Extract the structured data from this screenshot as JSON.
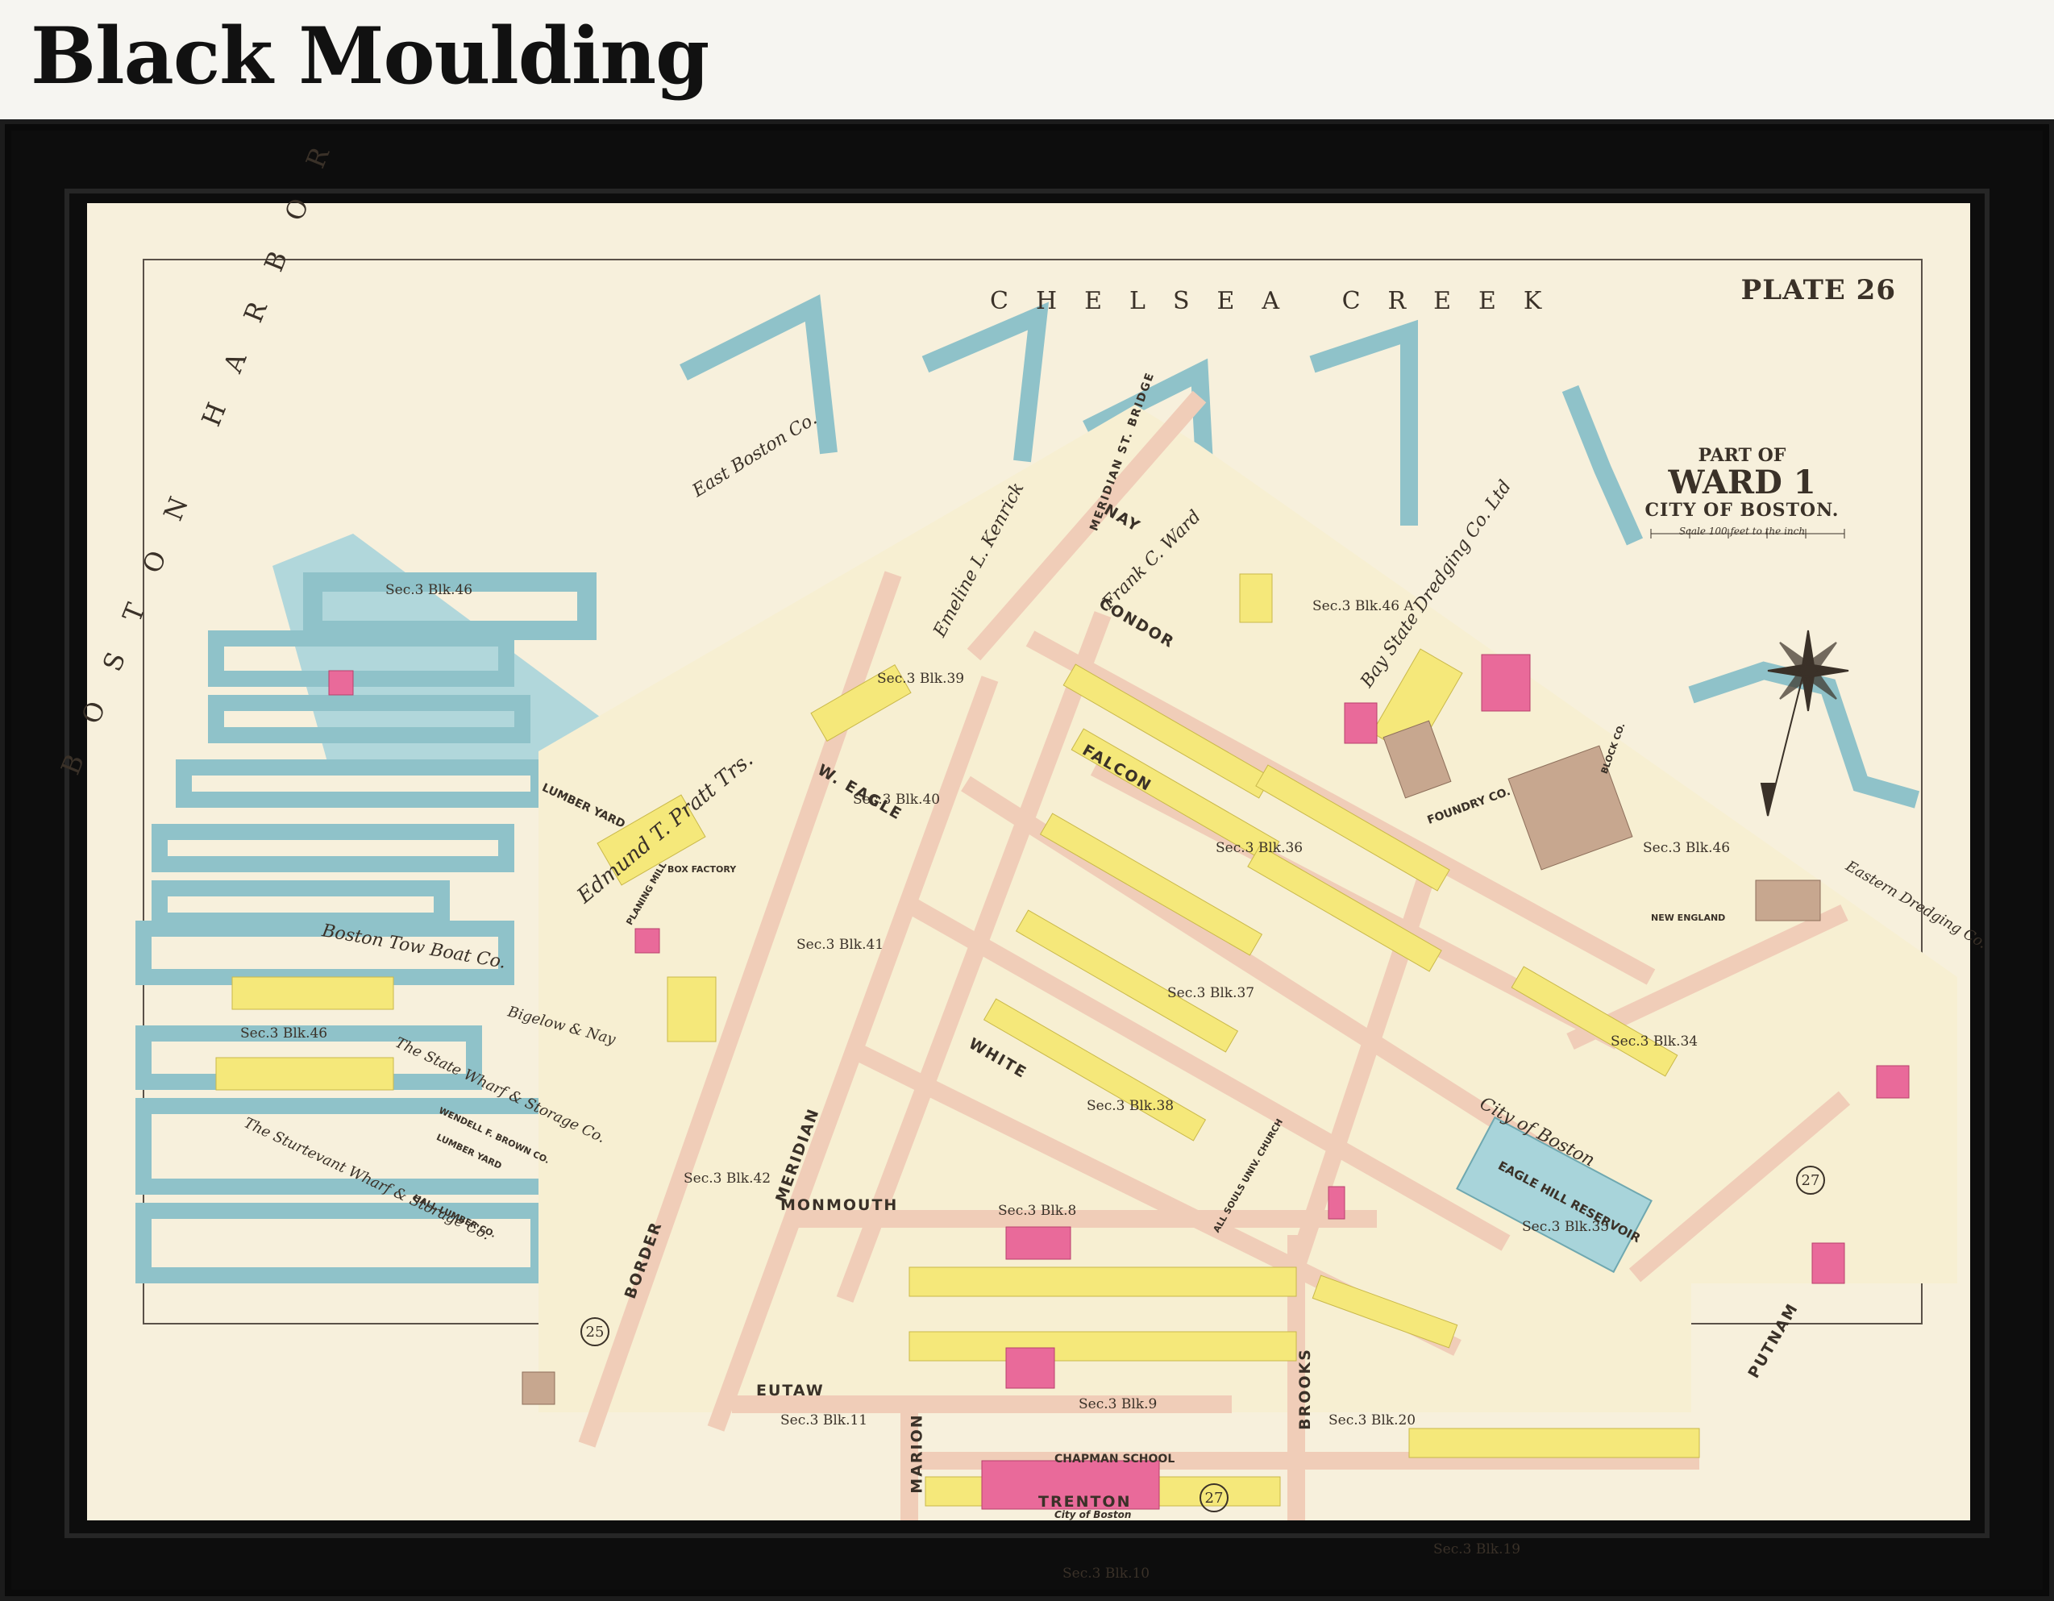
{
  "page": {
    "title": "Black Moulding"
  },
  "map": {
    "plate": "PLATE 26",
    "title": {
      "part": "PART OF",
      "ward": "WARD 1",
      "city": "CITY OF BOSTON.",
      "scale": "Scale 100 feet to the inch"
    },
    "water": {
      "creek": "CHELSEA CREEK",
      "harbor": "BOSTON HARBOR",
      "reservoir": "EAGLE HILL RESERVOIR"
    },
    "streets": {
      "nay": "NAY",
      "condor": "CONDOR",
      "falcon": "FALCON",
      "w_eagle": "W. EAGLE",
      "white": "WHITE",
      "monmouth": "MONMOUTH",
      "eutaw": "EUTAW",
      "trenton": "TRENTON",
      "border": "BORDER",
      "meridian": "MERIDIAN",
      "marion": "MARION",
      "brooks": "BROOKS",
      "putnam": "PUTNAM",
      "st": "ST.",
      "bridge": "MERIDIAN ST. BRIDGE"
    },
    "owners": {
      "east_boston_co": "East Boston Co.",
      "emeline": "Emeline L. Kenrick",
      "frank_ward": "Frank C. Ward",
      "bay_state": "Bay State Dredging Co. Ltd",
      "edmund_pratt": "Edmund T. Pratt Trs.",
      "boston_tow": "Boston Tow Boat Co.",
      "bigelow": "Bigelow & Nay",
      "state_wharf": "The State Wharf & Storage Co.",
      "sturtevant": "The Sturtevant Wharf & Storage Co.",
      "city_of_boston": "City of Boston",
      "eastern_dredging": "Eastern Dredging Co."
    },
    "sections": {
      "s46": "Sec.3 Blk.46",
      "s46b": "Sec.3 Blk.46",
      "s46a": "Sec.3 Blk.46 A",
      "s39": "Sec.3 Blk.39",
      "s40": "Sec.3 Blk.40",
      "s41": "Sec.3 Blk.41",
      "s36": "Sec.3 Blk.36",
      "s37": "Sec.3 Blk.37",
      "s38": "Sec.3 Blk.38",
      "s34": "Sec.3 Blk.34",
      "s35": "Sec.3 Blk.35",
      "s42": "Sec.3 Blk.42",
      "s8": "Sec.3 Blk.8",
      "s9": "Sec.3 Blk.9",
      "s10": "Sec.3 Blk.10",
      "s11": "Sec.3 Blk.11",
      "s19": "Sec.3 Blk.19",
      "s20": "Sec.3 Blk.20",
      "s46c": "Sec.3 Blk.46"
    },
    "buildings": {
      "lumber_yard": "LUMBER YARD",
      "foundry": "FOUNDRY CO.",
      "chapman": "CHAPMAN SCHOOL",
      "chapman_sub": "City of Boston",
      "planing_mill": "PLANING MILL",
      "box_factory": "BOX FACTORY",
      "all_souls": "ALL SOULS UNIV. CHURCH",
      "wendell_brown": "WENDELL F. BROWN CO.",
      "lumber_yard2": "LUMBER YARD",
      "hall_lumber": "HALL LUMBER CO.",
      "block_co": "BLOCK CO.",
      "new_england": "NEW ENGLAND"
    },
    "adjacent": {
      "left": "25",
      "right": "27",
      "bottom": "27"
    }
  },
  "colors": {
    "paper": "#f7f0dc",
    "water": "#a8d4da",
    "land_yellow": "#f5e87a",
    "pink": "#e96a9a",
    "brown": "#c7a78f",
    "street_pink": "#f3d4c0",
    "frame": "#0d0d0d"
  }
}
